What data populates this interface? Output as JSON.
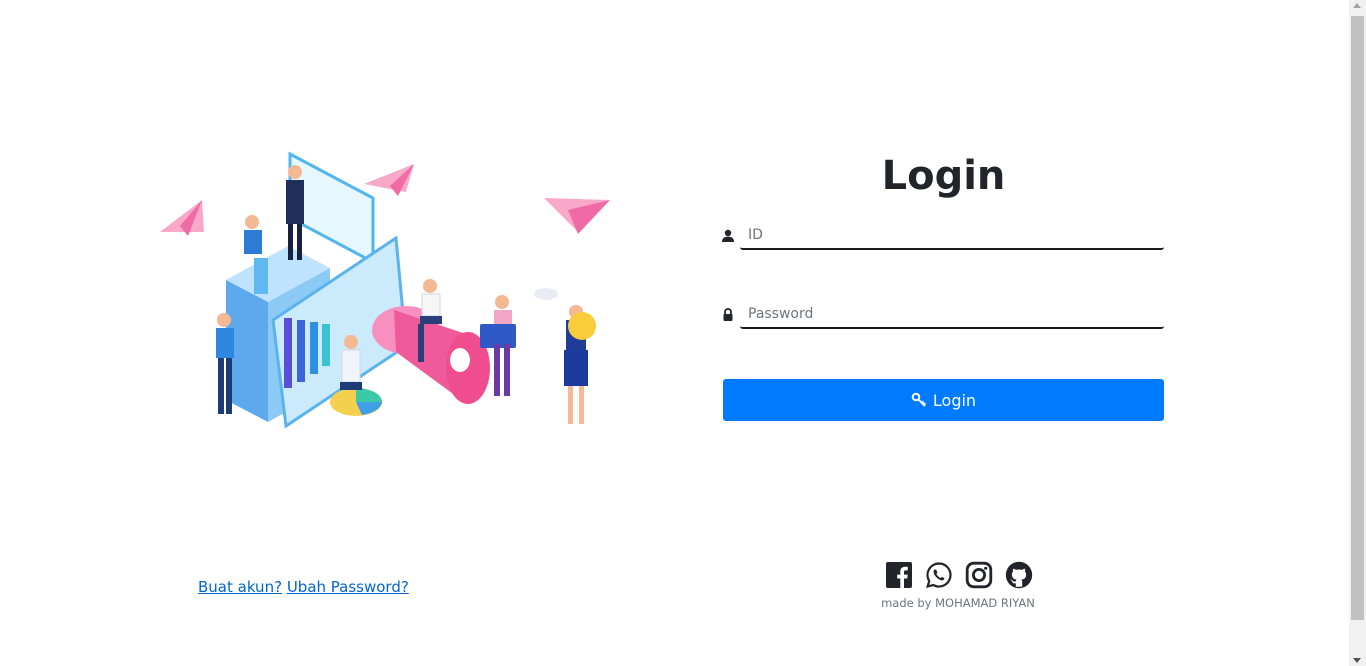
{
  "login": {
    "title": "Login",
    "id_placeholder": "ID",
    "password_placeholder": "Password",
    "button_label": "Login"
  },
  "footer": {
    "create_account_link": "Buat akun?",
    "change_password_link": "Ubah Password?",
    "credit": "made by MOHAMAD RIYAN",
    "social_icons": [
      "facebook-icon",
      "whatsapp-icon",
      "instagram-icon",
      "github-icon"
    ]
  },
  "colors": {
    "primary": "#007bff",
    "link": "#0066cc",
    "text_dark": "#212529",
    "muted": "#6c757d"
  }
}
